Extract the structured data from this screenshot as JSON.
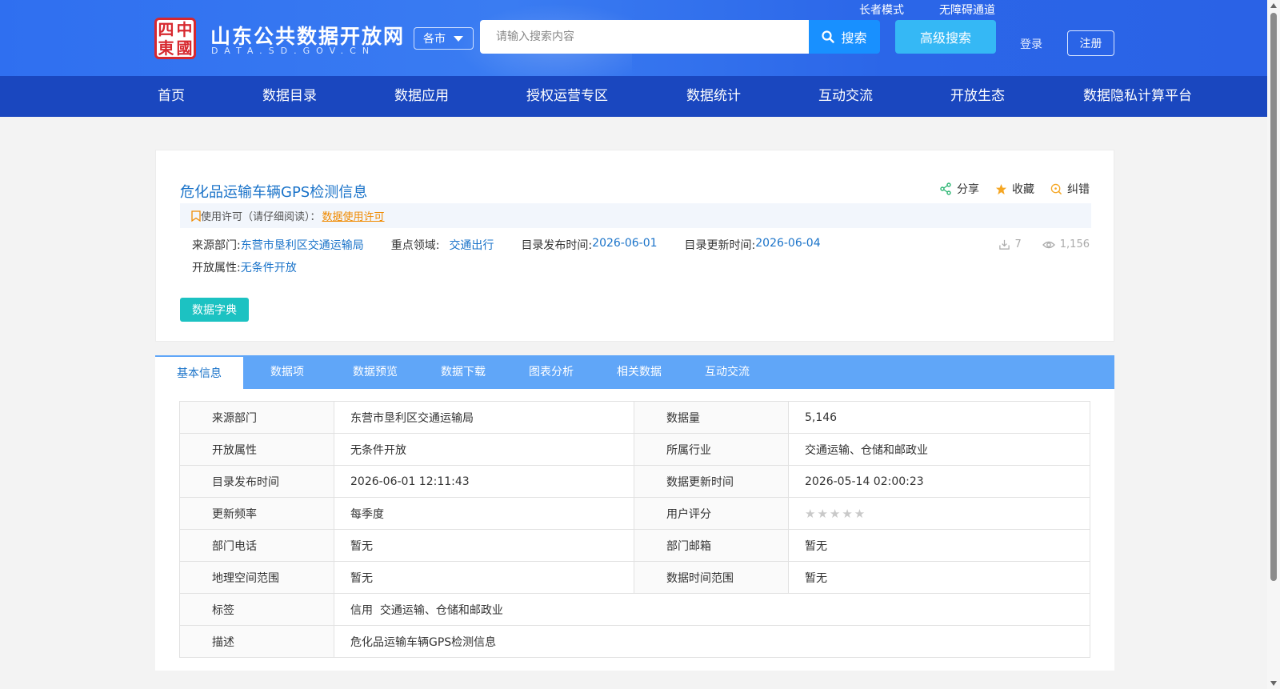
{
  "header": {
    "seal_chars": [
      "四",
      "中",
      "東",
      "國"
    ],
    "site_title": "山东公共数据开放网",
    "site_domain": "DATA.SD.GOV.CN",
    "city_select": "各市",
    "search_placeholder": "请输入搜索内容",
    "search_button": "搜索",
    "advanced_search": "高级搜索",
    "elder_mode": "长者模式",
    "accessibility": "无障碍通道",
    "login": "登录",
    "register": "注册"
  },
  "nav": [
    "首页",
    "数据目录",
    "数据应用",
    "授权运营专区",
    "数据统计",
    "互动交流",
    "开放生态",
    "数据隐私计算平台"
  ],
  "dataset": {
    "title": "危化品运输车辆GPS检测信息",
    "actions": {
      "share": "分享",
      "favorite": "收藏",
      "report": "纠错"
    },
    "license_prefix": "使用许可（请仔细阅读）：",
    "license_link": "数据使用许可",
    "meta": {
      "source_label": "来源部门:",
      "source_value": "东营市垦利区交通运输局",
      "domain_label": "重点领域:",
      "domain_value": "交通出行",
      "publish_label": "目录发布时间:",
      "publish_value": "2026-06-01",
      "update_label": "目录更新时间:",
      "update_value": "2026-06-04",
      "open_label": "开放属性:",
      "open_value": "无条件开放"
    },
    "downloads": "7",
    "views": "1,156",
    "dict_button": "数据字典"
  },
  "tabs": [
    "基本信息",
    "数据项",
    "数据预览",
    "数据下载",
    "图表分析",
    "相关数据",
    "互动交流"
  ],
  "info_table": {
    "rows": [
      {
        "k1": "来源部门",
        "v1": "东营市垦利区交通运输局",
        "k2": "数据量",
        "v2": "5,146"
      },
      {
        "k1": "开放属性",
        "v1": "无条件开放",
        "k2": "所属行业",
        "v2": "交通运输、仓储和邮政业"
      },
      {
        "k1": "目录发布时间",
        "v1": "2026-06-01 12:11:43",
        "k2": "数据更新时间",
        "v2": "2026-05-14 02:00:23"
      },
      {
        "k1": "更新频率",
        "v1": "每季度",
        "k2": "用户评分",
        "v2": "★★★★★"
      },
      {
        "k1": "部门电话",
        "v1": "暂无",
        "k2": "部门邮箱",
        "v2": "暂无"
      },
      {
        "k1": "地理空间范围",
        "v1": "暂无",
        "k2": "数据时间范围",
        "v2": "暂无"
      }
    ],
    "tags_label": "标签",
    "tags_value": "信用  交通运输、仓储和邮政业",
    "desc_label": "描述",
    "desc_value": "危化品运输车辆GPS检测信息"
  },
  "colors": {
    "header_blue": "#2f6ff0",
    "nav_blue": "#1a47bf",
    "link_blue": "#1a73c9",
    "tab_bar": "#60a6f8",
    "license_orange": "#f08a00",
    "dict_teal": "#1cc2c2"
  }
}
